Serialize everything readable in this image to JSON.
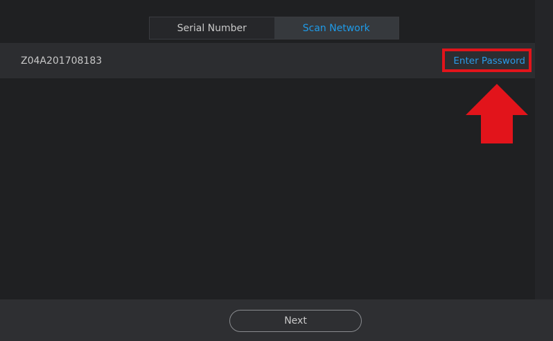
{
  "tabs": {
    "serial_number": "Serial Number",
    "scan_network": "Scan Network"
  },
  "device": {
    "serial": "Z04A201708183",
    "action_label": "Enter Password"
  },
  "footer": {
    "next_label": "Next"
  },
  "colors": {
    "accent": "#1e9be9",
    "annotation": "#e2141b"
  }
}
